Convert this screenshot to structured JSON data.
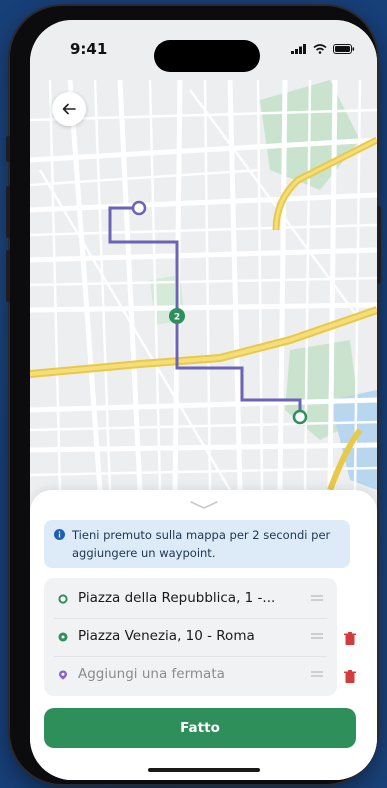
{
  "status_bar": {
    "time": "9:41"
  },
  "map": {
    "waypoint_badge": "2"
  },
  "info": {
    "text": "Tieni premuto sulla mappa per 2 secondi per aggiungere un waypoint."
  },
  "stops": [
    {
      "label": "Piazza della Repubblica, 1 -...",
      "kind": "origin",
      "color": "#2f8f5b"
    },
    {
      "label": "Piazza Venezia, 10 - Roma",
      "kind": "waypoint",
      "color": "#2f8f5b"
    },
    {
      "label": "Aggiungi una fermata",
      "kind": "placeholder",
      "color": "#8a63c9"
    }
  ],
  "actions": {
    "done_label": "Fatto"
  },
  "colors": {
    "accent": "#2f8f5b",
    "route": "#6b63b5",
    "delete": "#d23c3c",
    "info_bg": "#dcebf7"
  }
}
